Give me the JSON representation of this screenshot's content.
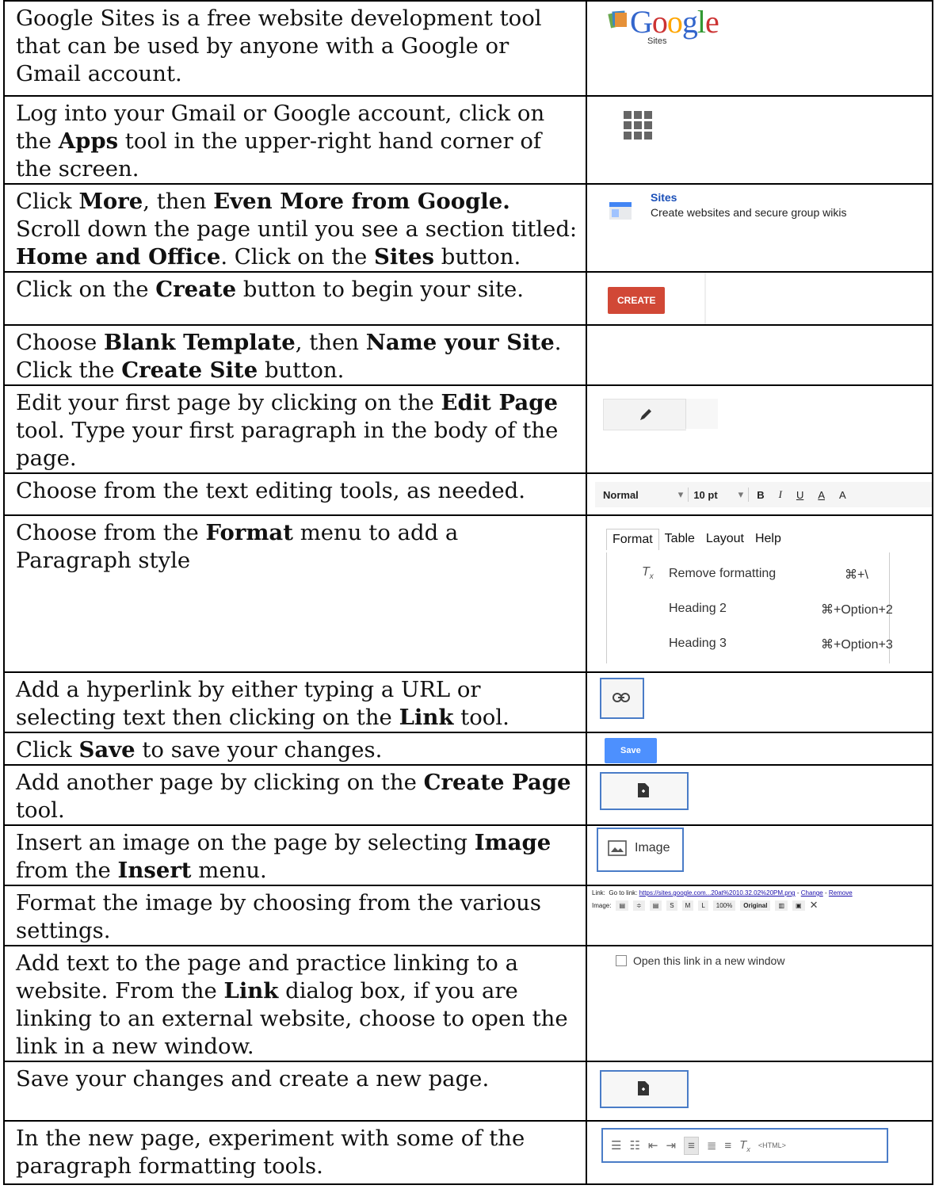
{
  "rows": [
    {
      "segments": [
        {
          "t": "Google Sites is a free website development tool that can be used by anyone with a Google or Gmail account.",
          "b": false
        }
      ]
    },
    {
      "segments": [
        {
          "t": "Log into your Gmail or Google account, click on the ",
          "b": false
        },
        {
          "t": "Apps",
          "b": true
        },
        {
          "t": " tool in the upper-right hand corner of the screen.",
          "b": false
        }
      ]
    },
    {
      "segments": [
        {
          "t": "Click ",
          "b": false
        },
        {
          "t": "More",
          "b": true
        },
        {
          "t": ", then ",
          "b": false
        },
        {
          "t": "Even More from Google.",
          "b": true
        },
        {
          "t": " Scroll down the page until you see a section titled: ",
          "b": false
        },
        {
          "t": "Home and Office",
          "b": true
        },
        {
          "t": ". Click on the ",
          "b": false
        },
        {
          "t": "Sites",
          "b": true
        },
        {
          "t": " button.",
          "b": false
        }
      ]
    },
    {
      "segments": [
        {
          "t": "Click on the ",
          "b": false
        },
        {
          "t": "Create",
          "b": true
        },
        {
          "t": " button to begin your site.",
          "b": false
        }
      ]
    },
    {
      "segments": [
        {
          "t": "Choose ",
          "b": false
        },
        {
          "t": "Blank Template",
          "b": true
        },
        {
          "t": ", then ",
          "b": false
        },
        {
          "t": "Name your Site",
          "b": true
        },
        {
          "t": ". Click the ",
          "b": false
        },
        {
          "t": "Create Site",
          "b": true
        },
        {
          "t": " button.",
          "b": false
        }
      ]
    },
    {
      "segments": [
        {
          "t": "Edit your first page by clicking on the ",
          "b": false
        },
        {
          "t": "Edit Page",
          "b": true
        },
        {
          "t": " tool. Type your first paragraph in the body of the page.",
          "b": false
        }
      ]
    },
    {
      "segments": [
        {
          "t": "Choose from the text editing tools, as needed.",
          "b": false
        }
      ]
    },
    {
      "segments": [
        {
          "t": "Choose from the ",
          "b": false
        },
        {
          "t": "Format",
          "b": true
        },
        {
          "t": " menu to add a Paragraph style",
          "b": false
        }
      ]
    },
    {
      "segments": [
        {
          "t": "Add a hyperlink by either typing a URL or selecting text then clicking on the ",
          "b": false
        },
        {
          "t": "Link",
          "b": true
        },
        {
          "t": " tool.",
          "b": false
        }
      ]
    },
    {
      "segments": [
        {
          "t": "Click ",
          "b": false
        },
        {
          "t": "Save",
          "b": true
        },
        {
          "t": " to save your changes.",
          "b": false
        }
      ]
    },
    {
      "segments": [
        {
          "t": "Add another page by clicking on the ",
          "b": false
        },
        {
          "t": "Create Page",
          "b": true
        },
        {
          "t": " tool.",
          "b": false
        }
      ]
    },
    {
      "segments": [
        {
          "t": "Insert an image on the page by selecting ",
          "b": false
        },
        {
          "t": "Image",
          "b": true
        },
        {
          "t": " from the ",
          "b": false
        },
        {
          "t": "Insert",
          "b": true
        },
        {
          "t": " menu.",
          "b": false
        }
      ]
    },
    {
      "segments": [
        {
          "t": "Format the image by choosing from the various settings.",
          "b": false
        }
      ]
    },
    {
      "segments": [
        {
          "t": "Add text to the page and practice linking to a website. From the ",
          "b": false
        },
        {
          "t": "Link",
          "b": true
        },
        {
          "t": " dialog box, if you are linking to an external website, choose to open the link in a new window.",
          "b": false
        }
      ]
    },
    {
      "segments": [
        {
          "t": "Save your changes and create a new page.",
          "b": false
        }
      ]
    },
    {
      "segments": [
        {
          "t": "In the new page, experiment with some of the paragraph formatting tools.",
          "b": false
        }
      ]
    }
  ],
  "ui": {
    "logo_word": "Google",
    "logo_sub": "Sites",
    "sites_title": "Sites",
    "sites_desc": "Create websites and secure group wikis",
    "create_label": "CREATE",
    "toolbar": {
      "style": "Normal",
      "size": "10 pt",
      "bold": "B",
      "italic": "I",
      "underline": "U",
      "color": "A",
      "bg": "A"
    },
    "format_menu": {
      "items": [
        "Format",
        "Table",
        "Layout",
        "Help"
      ],
      "entries": [
        {
          "label": "Remove formatting",
          "shortcut": "⌘+\\"
        },
        {
          "label": "Heading 2",
          "shortcut": "⌘+Option+2"
        },
        {
          "label": "Heading 3",
          "shortcut": "⌘+Option+3"
        }
      ]
    },
    "save_label": "Save",
    "image_label": "Image",
    "image_bar": {
      "link_label": "Link:",
      "go_to": "Go to link:",
      "url": "https://sites.google.com...20at%2010.32.02%20PM.png",
      "change": "Change",
      "remove": "Remove",
      "image_label": "Image:",
      "sizes": [
        "S",
        "M",
        "L",
        "100%",
        "Original"
      ]
    },
    "checkbox_label": "Open this link in a new window",
    "html_label": "<HTML>"
  }
}
